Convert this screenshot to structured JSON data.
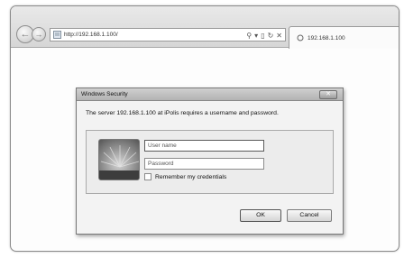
{
  "browser": {
    "address": "http://192.168.1.100/",
    "address_controls": {
      "search": "⚲",
      "dropdown": "▾",
      "compat": "▯",
      "refresh": "↻",
      "stop": "✕"
    },
    "tab_title": "192.168.1.100"
  },
  "dialog": {
    "title": "Windows Security",
    "close_label": "✕",
    "message": "The server 192.168.1.100 at iPolis requires a username and password.",
    "username_placeholder": "User name",
    "password_placeholder": "Password",
    "remember_label": "Remember my credentials",
    "ok_label": "OK",
    "cancel_label": "Cancel"
  }
}
